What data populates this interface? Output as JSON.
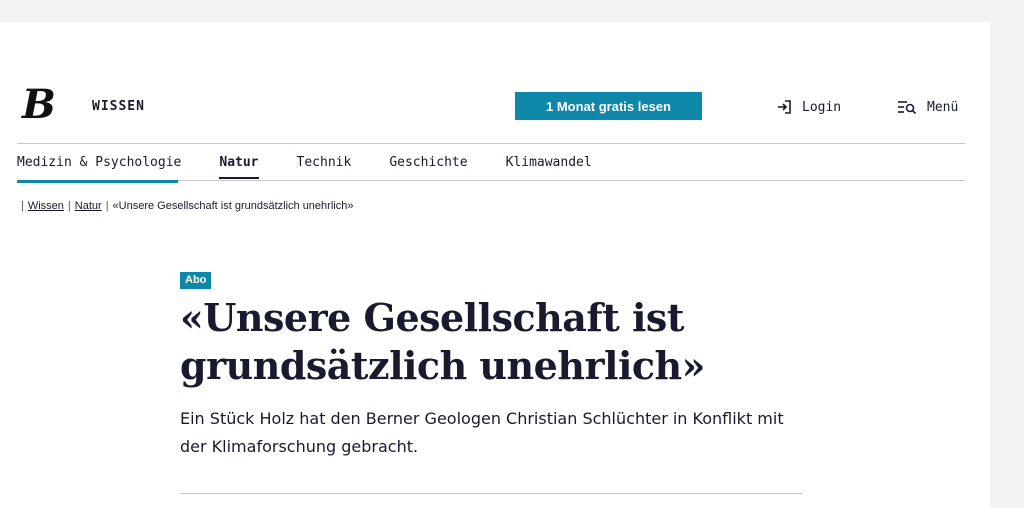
{
  "header": {
    "logo_letter": "B",
    "section": "WISSEN",
    "cta_label": "1 Monat gratis lesen",
    "login_label": "Login",
    "menu_label": "Menü"
  },
  "nav": {
    "items": [
      {
        "label": "Medizin & Psychologie"
      },
      {
        "label": "Natur"
      },
      {
        "label": "Technik"
      },
      {
        "label": "Geschichte"
      },
      {
        "label": "Klimawandel"
      }
    ],
    "active": "Natur"
  },
  "breadcrumb": {
    "items": [
      "Wissen",
      "Natur",
      "«Unsere Gesellschaft ist grundsätzlich unehrlich»"
    ]
  },
  "article": {
    "badge": "Abo",
    "headline": "«Unsere Gesellschaft ist grundsätzlich unehrlich»",
    "lead": "Ein Stück Holz hat den Berner Geologen Christian Schlüchter in Konflikt mit der Klimaforschung gebracht."
  },
  "colors": {
    "accent": "#0f87a8",
    "text": "#1a1a2e"
  }
}
